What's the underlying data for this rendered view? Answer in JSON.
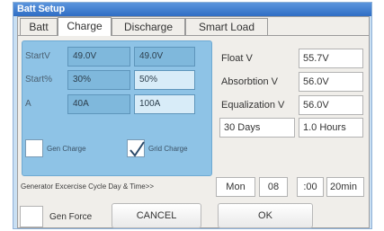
{
  "window": {
    "title": "Batt Setup"
  },
  "tabs": [
    {
      "label": "Batt"
    },
    {
      "label": "Charge"
    },
    {
      "label": "Discharge"
    },
    {
      "label": "Smart Load"
    }
  ],
  "generator": {
    "rows": [
      {
        "label": "StartV",
        "value_a": "49.0V",
        "value_b": "49.0V"
      },
      {
        "label": "Start%",
        "value_a": "30%",
        "value_b": "50%"
      },
      {
        "label": "A",
        "value_a": "40A",
        "value_b": "100A"
      }
    ],
    "gen_charge_label": "Gen Charge",
    "grid_charge_label": "Grid Charge"
  },
  "charge": {
    "float_label": "Float V",
    "float_value": "55.7V",
    "absorption_label": "Absorbtion V",
    "absorption_value": "56.0V",
    "equalization_label": "Equalization V",
    "equalization_value": "56.0V",
    "eq_days_value": "30 Days",
    "eq_hours_value": "1.0 Hours"
  },
  "exercise": {
    "label": "Generator Excercise Cycle Day & Time>>",
    "day_value": "Mon",
    "hour_value": "08",
    "minute_value": ":00",
    "duration_value": "20min"
  },
  "footer": {
    "gen_force_label": "Gen Force",
    "cancel_label": "CANCEL",
    "ok_label": "OK"
  }
}
